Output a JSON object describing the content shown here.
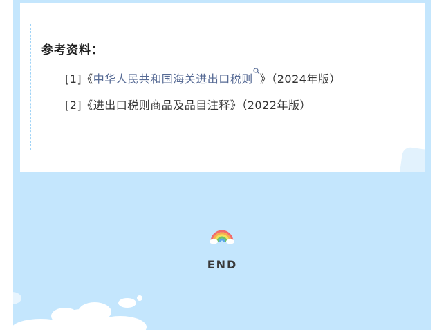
{
  "references": {
    "heading": "参考资料：",
    "items": [
      {
        "index": "[1]",
        "open_quote": "《",
        "title": "中华人民共和国海关进出口税则",
        "close_quote": "》",
        "edition": "（2024年版）"
      },
      {
        "index": "[2]",
        "open_quote": "《",
        "title": "进出口税则商品及品目注释",
        "close_quote": "》",
        "edition": "（2022年版）"
      }
    ]
  },
  "footer": {
    "end_label": "END",
    "decoration_icon": "rainbow-icon"
  },
  "colors": {
    "background_blue": "#c4e6fd",
    "card": "#ffffff",
    "link": "#576b95",
    "text": "#333333"
  }
}
